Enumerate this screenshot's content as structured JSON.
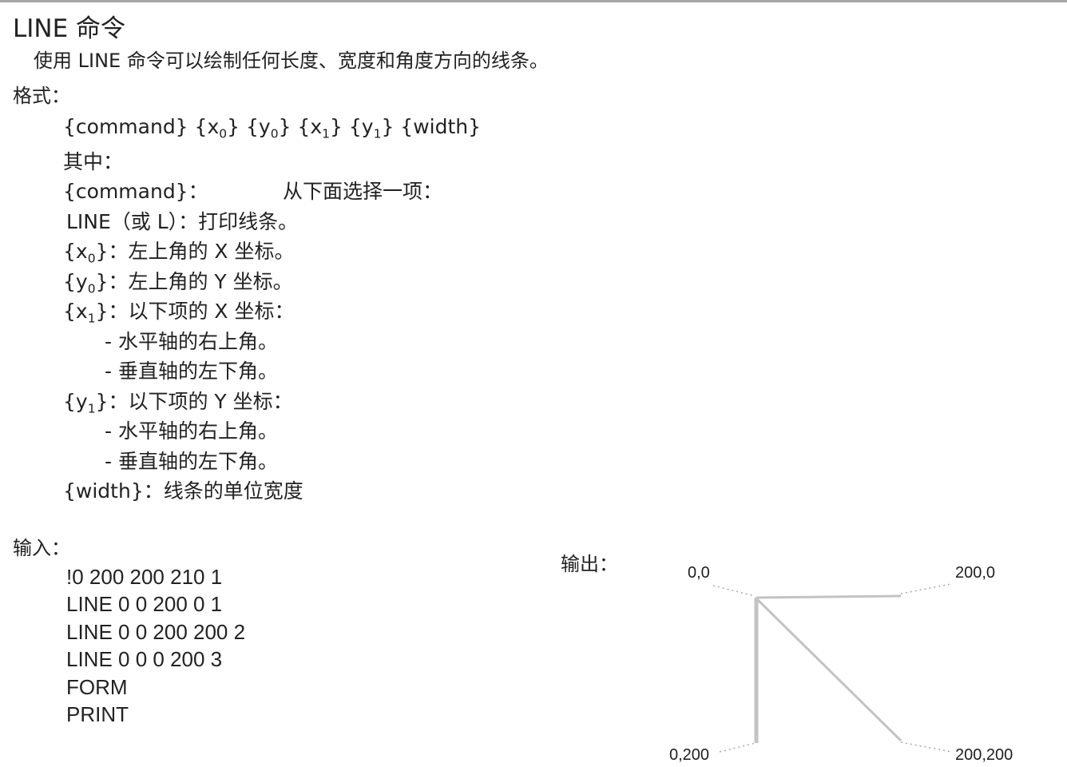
{
  "title": "LINE 命令",
  "intro": "使用 LINE 命令可以绘制任何长度、宽度和角度方向的线条。",
  "format_heading": "格式：",
  "syntax": {
    "command": "{command}",
    "x0_open": "{x",
    "x0_sub": "0",
    "x0_close": "}",
    "y0_open": "{y",
    "y0_sub": "0",
    "y0_close": "}",
    "x1_open": "{x",
    "x1_sub": "1",
    "x1_close": "}",
    "y1_open": "{y",
    "y1_sub": "1",
    "y1_close": "}",
    "width": "{width}"
  },
  "where_label": "其中：",
  "params": {
    "command_label": "{command}：",
    "command_desc": "从下面选择一项：",
    "line_option": "LINE（或 L）：打印线条。",
    "x0_open": "{x",
    "x0_sub": "0",
    "x0_desc": "}：左上角的 X 坐标。",
    "y0_open": "{y",
    "y0_sub": "0",
    "y0_desc": "}：左上角的 Y 坐标。",
    "x1_open": "{x",
    "x1_sub": "1",
    "x1_desc": "}：以下项的 X 坐标：",
    "x1_item1": "- 水平轴的右上角。",
    "x1_item2": "- 垂直轴的左下角。",
    "y1_open": "{y",
    "y1_sub": "1",
    "y1_desc": "}：以下项的 Y 坐标：",
    "y1_item1": "- 水平轴的右上角。",
    "y1_item2": "- 垂直轴的左下角。",
    "width_desc": "{width}：线条的单位宽度"
  },
  "input_heading": "输入：",
  "input_lines": [
    "!0 200 200 210 1",
    "LINE 0 0 200 0 1",
    "LINE 0 0 200 200 2",
    "LINE 0 0 0 200 3",
    "FORM",
    "PRINT"
  ],
  "output_heading": "输出：",
  "output_corners": {
    "top_left": "0,0",
    "top_right": "200,0",
    "bottom_left": "0,200",
    "bottom_right": "200,200"
  },
  "line_color": "#c3c3c3"
}
